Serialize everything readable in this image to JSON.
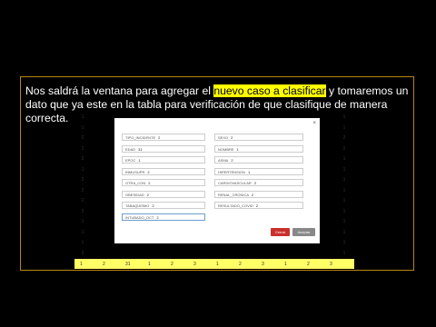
{
  "caption": {
    "before": "Nos saldrá la ventana para agregar el ",
    "highlight": "nuevo caso a clasificar",
    "after": " y tomaremos un dato que ya este en la tabla para verificación de que clasifique de manera correcta."
  },
  "colors": {
    "highlight": "#ffff00",
    "cancel": "#c9302c",
    "accept": "#888888",
    "border": "#b8860b"
  },
  "table": {
    "left_col": [
      "1",
      "1",
      "2",
      "2",
      "2",
      "1",
      "2",
      "2",
      "2",
      "2",
      "1",
      "1",
      "1",
      "2"
    ],
    "right_col": [
      "1",
      "1",
      "2",
      "2",
      "1",
      "1",
      "1",
      "1",
      "1",
      "1",
      "1",
      "1",
      "1",
      "1"
    ],
    "highlight_row": [
      "1",
      "2",
      "31",
      "1",
      "2",
      "3",
      "1",
      "2",
      "3",
      "1",
      "2",
      "3"
    ]
  },
  "dialog": {
    "close": "×",
    "fields": [
      {
        "label": "TIPO_INCIDENTE",
        "value": "2"
      },
      {
        "label": "SEXO",
        "value": "2"
      },
      {
        "label": "EDAD",
        "value": "31"
      },
      {
        "label": "NOMBRE",
        "value": "1"
      },
      {
        "label": "EPOC",
        "value": "1"
      },
      {
        "label": "ASMA",
        "value": "2"
      },
      {
        "label": "INMUSUPR",
        "value": "2"
      },
      {
        "label": "HIPERTENSION",
        "value": "1"
      },
      {
        "label": "OTRA_CON",
        "value": "2"
      },
      {
        "label": "CARDIOVASCULAR",
        "value": "2"
      },
      {
        "label": "OBESIDAD",
        "value": "2"
      },
      {
        "label": "RENAL_CRONICA",
        "value": "2"
      },
      {
        "label": "TABAQUISMO",
        "value": "2"
      },
      {
        "label": "RESULTADO_COVID",
        "value": "2"
      },
      {
        "label": "INTUBADO_OCT",
        "value": "2"
      }
    ],
    "cancel_label": "Cerrar",
    "accept_label": "Aceptar"
  }
}
